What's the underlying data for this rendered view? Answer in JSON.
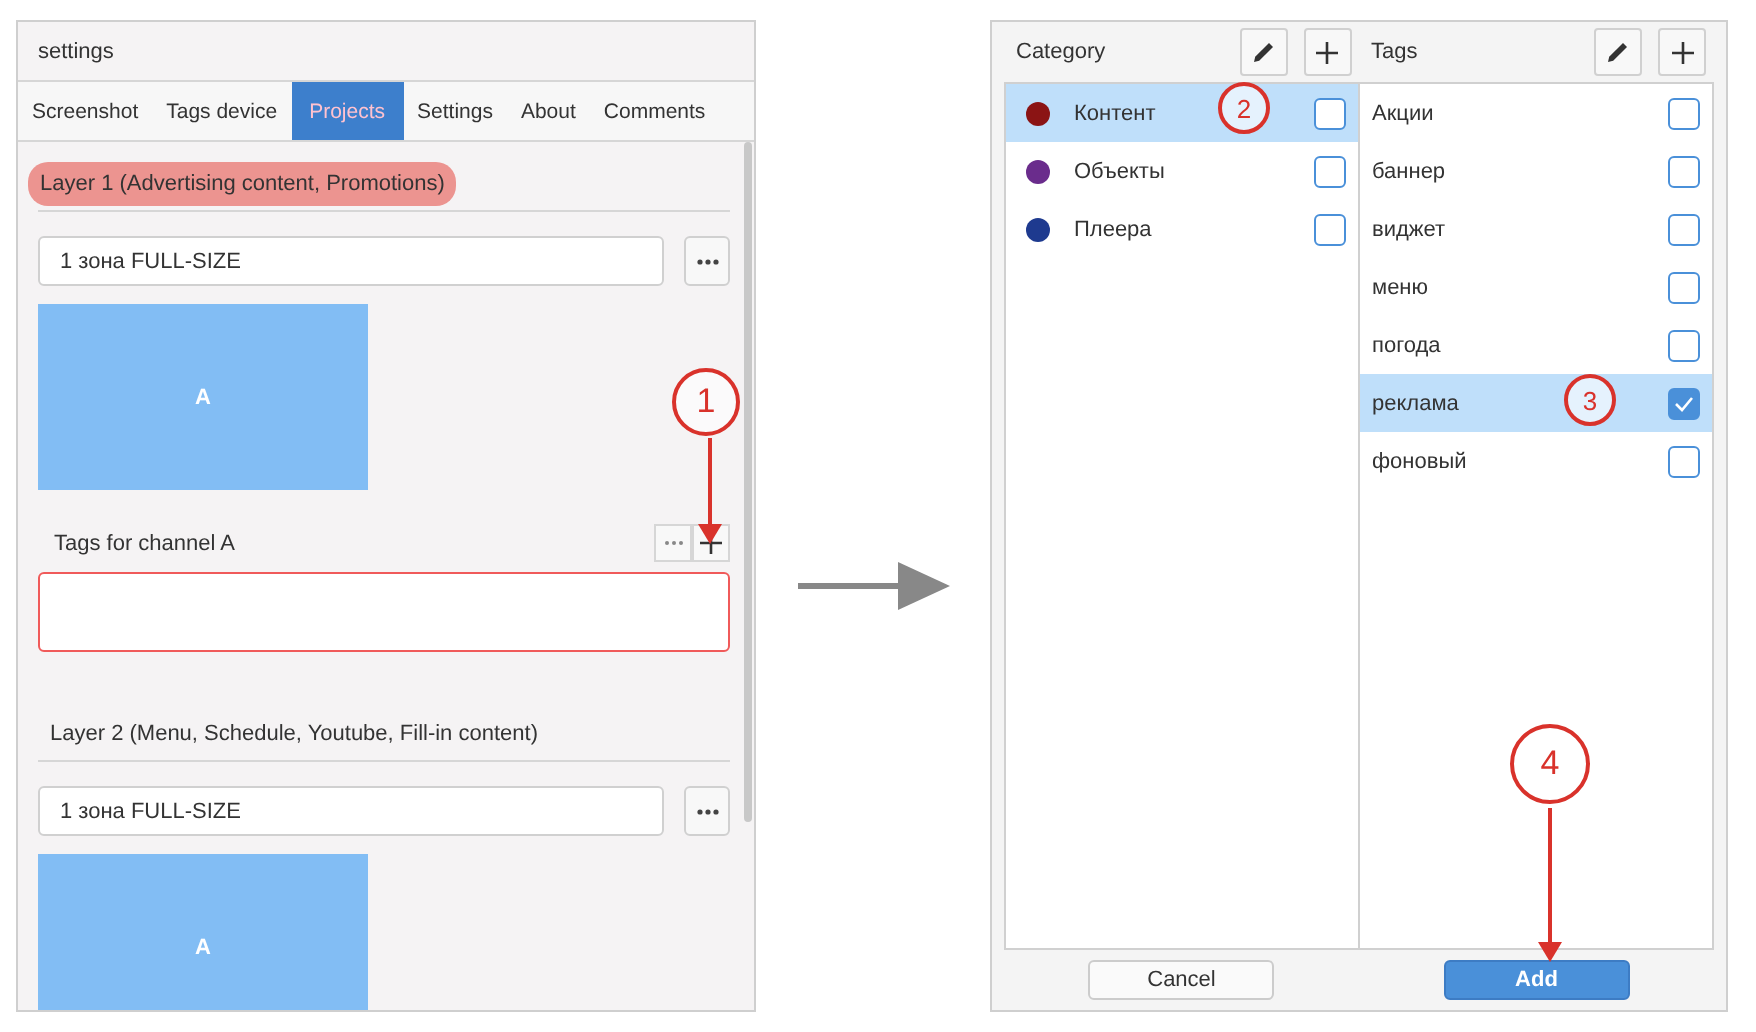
{
  "settings_panel": {
    "title": "settings",
    "tabs": [
      {
        "label": "Screenshot",
        "selected": false
      },
      {
        "label": "Tags device",
        "selected": false
      },
      {
        "label": "Projects",
        "selected": true
      },
      {
        "label": "Settings",
        "selected": false
      },
      {
        "label": "About",
        "selected": false
      },
      {
        "label": "Comments",
        "selected": false
      }
    ],
    "layers": [
      {
        "title": "Layer 1 (Advertising content, Promotions)",
        "highlighted": true,
        "zone_field": "1 зона FULL-SIZE",
        "zone_label": "A",
        "tags_label": "Tags for channel A",
        "tags_invalid": true
      },
      {
        "title": "Layer 2 (Menu, Schedule, Youtube, Fill-in content)",
        "highlighted": false,
        "zone_field": "1 зона FULL-SIZE",
        "zone_label": "A"
      }
    ]
  },
  "tag_dialog": {
    "category_title": "Category",
    "tags_title": "Tags",
    "categories": [
      {
        "name": "Контент",
        "color": "#8b1414",
        "selected": true,
        "checked": false
      },
      {
        "name": "Объекты",
        "color": "#6a2c8c",
        "selected": false,
        "checked": false
      },
      {
        "name": "Плеера",
        "color": "#1e3a8f",
        "selected": false,
        "checked": false
      }
    ],
    "tags": [
      {
        "name": "Акции",
        "selected": false,
        "checked": false
      },
      {
        "name": "баннер",
        "selected": false,
        "checked": false
      },
      {
        "name": "виджет",
        "selected": false,
        "checked": false
      },
      {
        "name": "меню",
        "selected": false,
        "checked": false
      },
      {
        "name": "погода",
        "selected": false,
        "checked": false
      },
      {
        "name": "реклама",
        "selected": true,
        "checked": true
      },
      {
        "name": "фоновый",
        "selected": false,
        "checked": false
      }
    ],
    "buttons": [
      {
        "label": "Cancel",
        "kind": "secondary"
      },
      {
        "label": "Add",
        "kind": "primary"
      }
    ]
  },
  "annotations": [
    {
      "number": "1"
    },
    {
      "number": "2"
    },
    {
      "number": "3"
    },
    {
      "number": "4"
    }
  ]
}
